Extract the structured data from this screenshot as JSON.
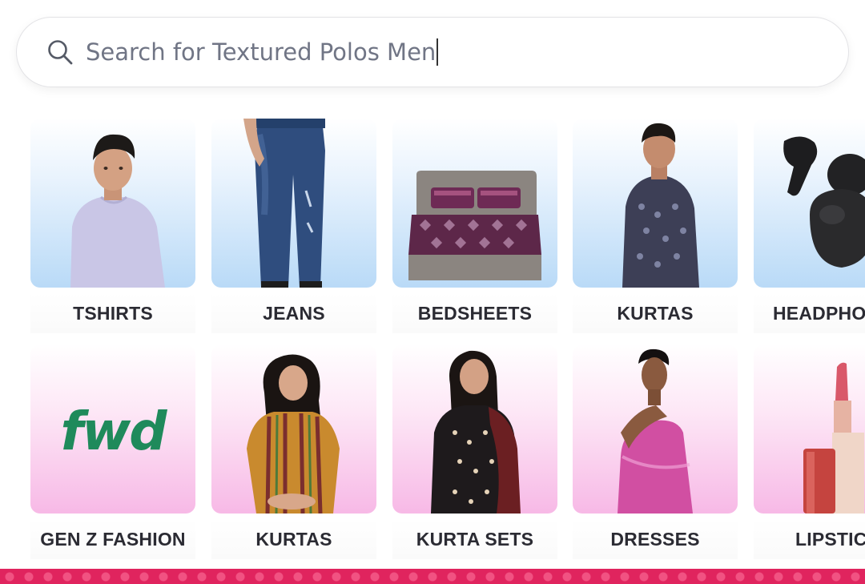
{
  "search": {
    "placeholder": "Search for Textured Polos Men"
  },
  "categories_row1": [
    {
      "label": "TSHIRTS"
    },
    {
      "label": "JEANS"
    },
    {
      "label": "BEDSHEETS"
    },
    {
      "label": "KURTAS"
    },
    {
      "label": "HEADPHO"
    }
  ],
  "categories_row2": [
    {
      "label": "GEN Z FASHION"
    },
    {
      "label": "KURTAS"
    },
    {
      "label": "KURTA SETS"
    },
    {
      "label": "DRESSES"
    },
    {
      "label": "LIPSTIC"
    }
  ],
  "brand_tile": {
    "logo_text": "fwd"
  },
  "colors": {
    "accent_strip": "#e0245e",
    "fwd_green": "#1f8a5b",
    "tile_blue": "#b9daf7",
    "tile_pink": "#f7b9e6"
  }
}
